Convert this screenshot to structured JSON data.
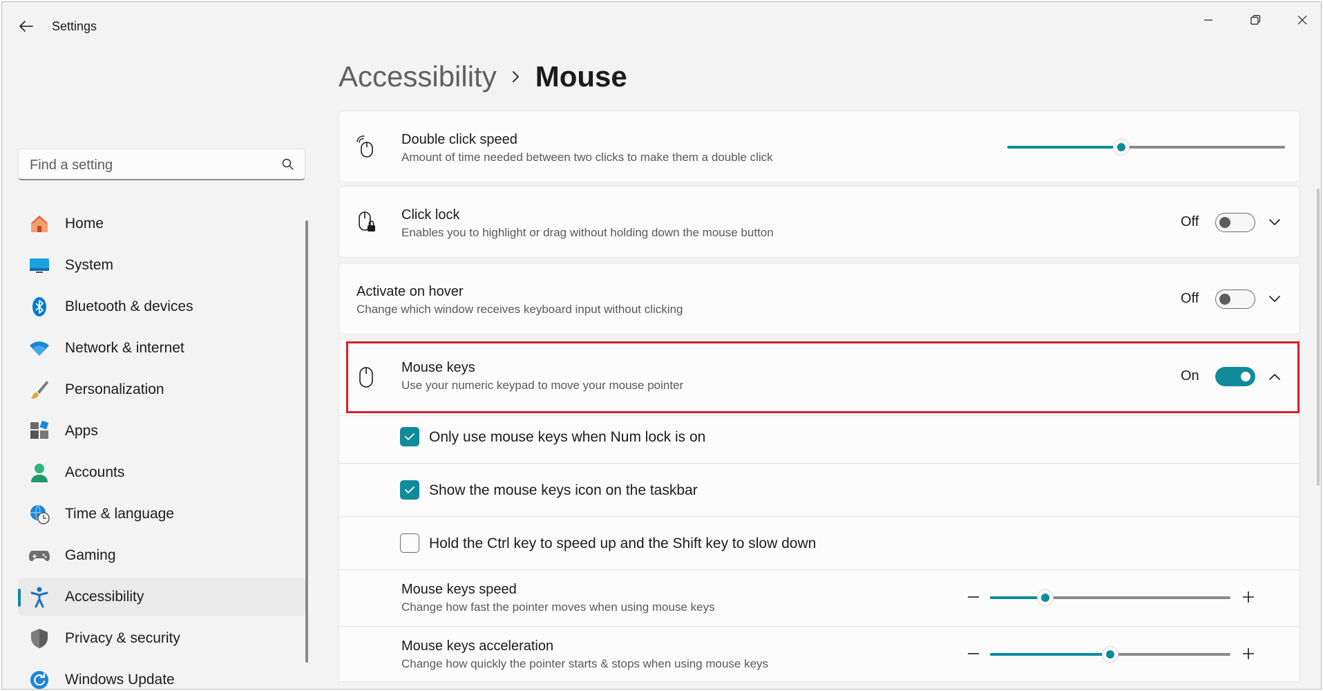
{
  "window": {
    "title": "Settings",
    "controls": [
      "minimize-icon",
      "restore-icon",
      "close-icon"
    ]
  },
  "search": {
    "placeholder": "Find a setting"
  },
  "sidebar": {
    "items": [
      {
        "label": "Home",
        "icon": "home-icon"
      },
      {
        "label": "System",
        "icon": "system-icon"
      },
      {
        "label": "Bluetooth & devices",
        "icon": "bluetooth-icon"
      },
      {
        "label": "Network & internet",
        "icon": "wifi-icon"
      },
      {
        "label": "Personalization",
        "icon": "brush-icon"
      },
      {
        "label": "Apps",
        "icon": "apps-icon"
      },
      {
        "label": "Accounts",
        "icon": "accounts-icon"
      },
      {
        "label": "Time & language",
        "icon": "globe-clock-icon"
      },
      {
        "label": "Gaming",
        "icon": "gamepad-icon"
      },
      {
        "label": "Accessibility",
        "icon": "accessibility-icon",
        "active": true
      },
      {
        "label": "Privacy & security",
        "icon": "shield-icon"
      },
      {
        "label": "Windows Update",
        "icon": "update-icon"
      }
    ]
  },
  "breadcrumb": {
    "parent": "Accessibility",
    "current": "Mouse"
  },
  "settings": {
    "double_click": {
      "title": "Double click speed",
      "desc": "Amount of time needed between two clicks to make them a double click",
      "value_fraction": 0.41
    },
    "click_lock": {
      "title": "Click lock",
      "desc": "Enables you to highlight or drag without holding down the mouse button",
      "state": "Off"
    },
    "activate_hover": {
      "title": "Activate on hover",
      "desc": "Change which window receives keyboard input without clicking",
      "state": "Off"
    },
    "mouse_keys": {
      "title": "Mouse keys",
      "desc": "Use your numeric keypad to move your mouse pointer",
      "state": "On",
      "options": [
        {
          "label": "Only use mouse keys when Num lock is on",
          "checked": true
        },
        {
          "label": "Show the mouse keys icon on the taskbar",
          "checked": true
        },
        {
          "label": "Hold the Ctrl key to speed up and the Shift key to slow down",
          "checked": false
        }
      ],
      "speed": {
        "title": "Mouse keys speed",
        "desc": "Change how fast the pointer moves when using mouse keys",
        "value_fraction": 0.23
      },
      "acceleration": {
        "title": "Mouse keys acceleration",
        "desc": "Change how quickly the pointer starts & stops when using mouse keys",
        "value_fraction": 0.5
      }
    }
  },
  "colors": {
    "accent": "#0f8b9c",
    "highlight": "#d61f2b"
  }
}
